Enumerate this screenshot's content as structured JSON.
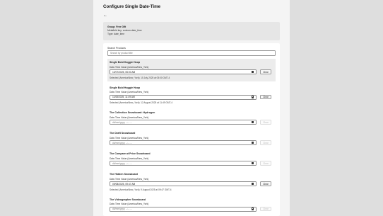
{
  "page": {
    "title": "Configure Single Date-Time",
    "back_icon": "←"
  },
  "info": {
    "group": "Group: Free Gift",
    "metafield": "Metafield key: custom.date_time",
    "type": "Type: date_time"
  },
  "search": {
    "label": "Search Products",
    "placeholder": "Search by product title"
  },
  "products": [
    {
      "name": "Single Bold Hoggie Hoop",
      "label": "Date-Time Value (America/New_York)",
      "value": "10/07/2025, 05:00 AM",
      "clear": "Clear",
      "selected_text": "Selected (America/New_York): 15 July 2025 at 05:00 GMT-4"
    },
    {
      "name": "Single Bold Hoggie Hoop",
      "label": "Date-Time Value (America/New_York)",
      "value": "11/08/2025, 11:49 AM",
      "clear": "Clear",
      "selected_text": "Selected (America/New_York): 12 August 2025 at 11:49 GMT-4"
    },
    {
      "name": "The Collection Snowboard: Hydrogen",
      "label": "Date-Time Value (America/New_York)",
      "value": "dd/mm/yyyy, --:-- --",
      "clear": "Clear"
    },
    {
      "name": "The Draft Snowboard",
      "label": "Date-Time Value (America/New_York)",
      "value": "dd/mm/yyyy, --:-- --",
      "clear": "Clear"
    },
    {
      "name": "The Compare at Price Snowboard",
      "label": "Date-Time Value (America/New_York)",
      "value": "dd/mm/yyyy, --:-- --",
      "clear": "Clear"
    },
    {
      "name": "The Hidden Snowboard",
      "label": "Date-Time Value (America/New_York)",
      "value": "09/08/2025, 09:47 AM",
      "clear": "Clear",
      "selected_text": "Selected (America/New_York): 9 August 2025 at 09:47 GMT-4"
    },
    {
      "name": "The Videographer Snowboard",
      "label": "Date-Time Value (America/New_York)",
      "value": "dd/mm/yyyy, --:-- --",
      "clear": "Clear"
    }
  ]
}
